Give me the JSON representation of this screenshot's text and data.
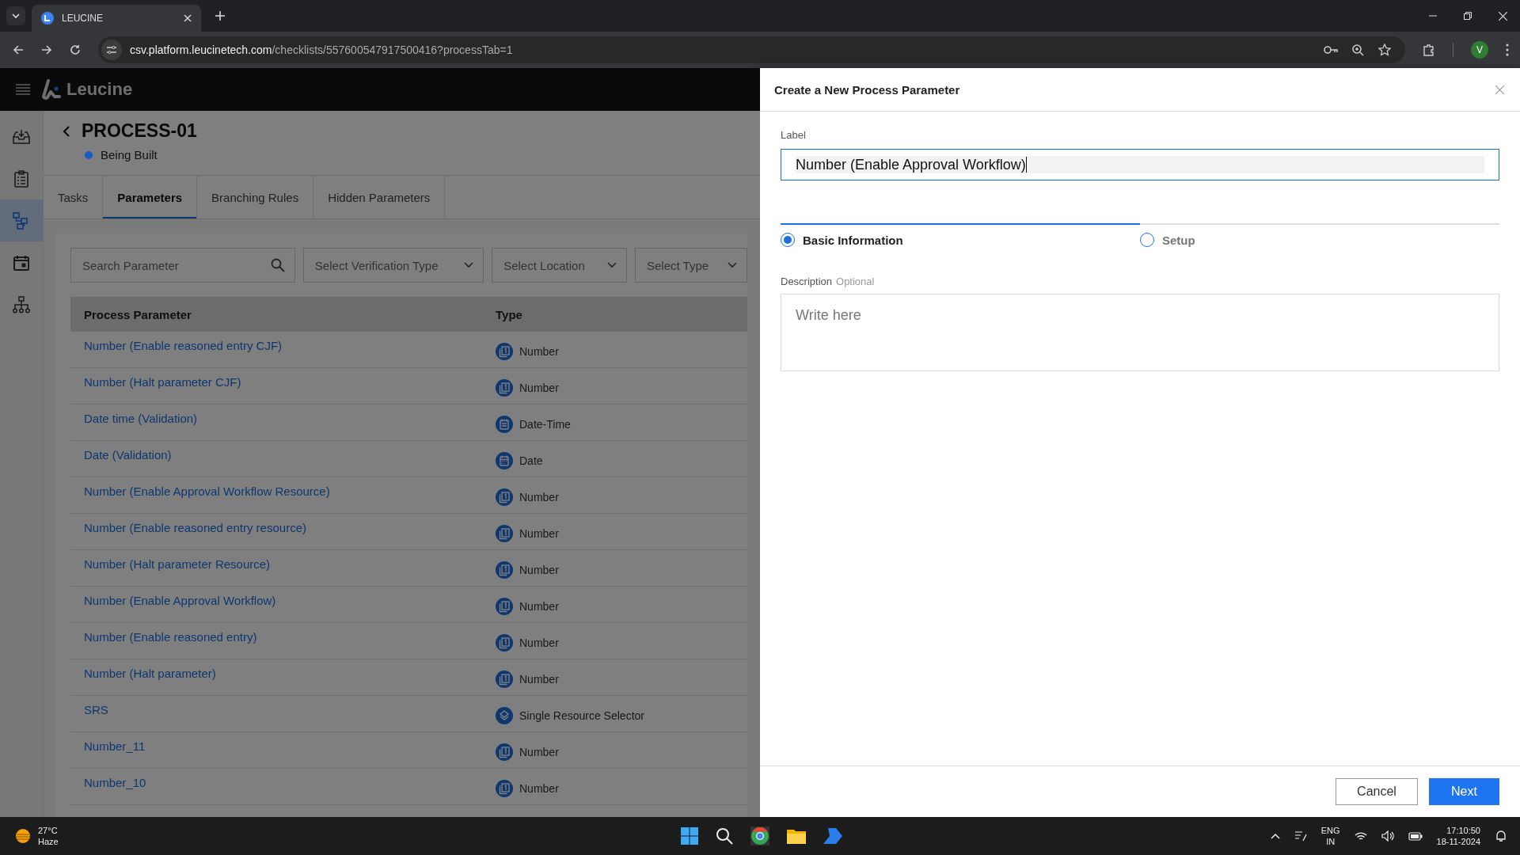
{
  "browser": {
    "tabs": [
      {
        "title": "LEUCINE",
        "selected": true
      }
    ],
    "url_host": "csv.platform.leucinetech.com",
    "url_path": "/checklists/557600547917500416?processTab=1",
    "profile": "V"
  },
  "app": {
    "brand": "Leucine",
    "sidebar": [
      {
        "kind": "inbox",
        "selected": false
      },
      {
        "kind": "checklist",
        "selected": false
      },
      {
        "kind": "process",
        "selected": true
      },
      {
        "kind": "calendar",
        "selected": false
      },
      {
        "kind": "hierarchy",
        "selected": false
      }
    ],
    "process": {
      "title": "PROCESS-01",
      "status": "Being Built",
      "color": "#1a5cc4"
    },
    "tabs": [
      {
        "label": "Tasks",
        "selected": false
      },
      {
        "label": "Parameters",
        "selected": true
      },
      {
        "label": "Branching Rules",
        "selected": false
      },
      {
        "label": "Hidden Parameters",
        "selected": false
      }
    ],
    "filters": {
      "search_placeholder": "Search Parameter",
      "dropdowns": [
        "Select Verification Type",
        "Select Location",
        "Select Type"
      ]
    },
    "table": {
      "columns": [
        "Process Parameter",
        "Type"
      ],
      "rows": [
        {
          "name": "Number (Enable reasoned entry CJF)",
          "type": "Number",
          "kind": "number"
        },
        {
          "name": "Number (Halt parameter CJF)",
          "type": "Number",
          "kind": "number"
        },
        {
          "name": "Date time (Validation)",
          "type": "Date-Time",
          "kind": "datetime"
        },
        {
          "name": "Date (Validation)",
          "type": "Date",
          "kind": "date"
        },
        {
          "name": "Number (Enable Approval Workflow Resource)",
          "type": "Number",
          "kind": "number"
        },
        {
          "name": "Number (Enable reasoned entry resource)",
          "type": "Number",
          "kind": "number"
        },
        {
          "name": "Number (Halt parameter Resource)",
          "type": "Number",
          "kind": "number"
        },
        {
          "name": "Number (Enable Approval Workflow)",
          "type": "Number",
          "kind": "number"
        },
        {
          "name": "Number (Enable reasoned entry)",
          "type": "Number",
          "kind": "number"
        },
        {
          "name": "Number (Halt parameter)",
          "type": "Number",
          "kind": "number"
        },
        {
          "name": "SRS",
          "type": "Single Resource Selector",
          "kind": "resource"
        },
        {
          "name": "Number_11",
          "type": "Number",
          "kind": "number"
        },
        {
          "name": "Number_10",
          "type": "Number",
          "kind": "number"
        }
      ]
    }
  },
  "dialog": {
    "title": "Create a New Process Parameter",
    "label_caption": "Label",
    "label_value": "Number (Enable Approval Workflow)",
    "steps": [
      {
        "label": "Basic Information",
        "selected": true
      },
      {
        "label": "Setup",
        "selected": false
      }
    ],
    "description_caption": "Description",
    "description_hint": "Optional",
    "description_placeholder": "Write here",
    "buttons": [
      "Cancel",
      "Next"
    ]
  },
  "taskbar": {
    "temperature": "27°C",
    "weather": "Haze",
    "language": "ENG",
    "region": "IN",
    "time": "17:10:50",
    "date": "18-11-2024"
  }
}
